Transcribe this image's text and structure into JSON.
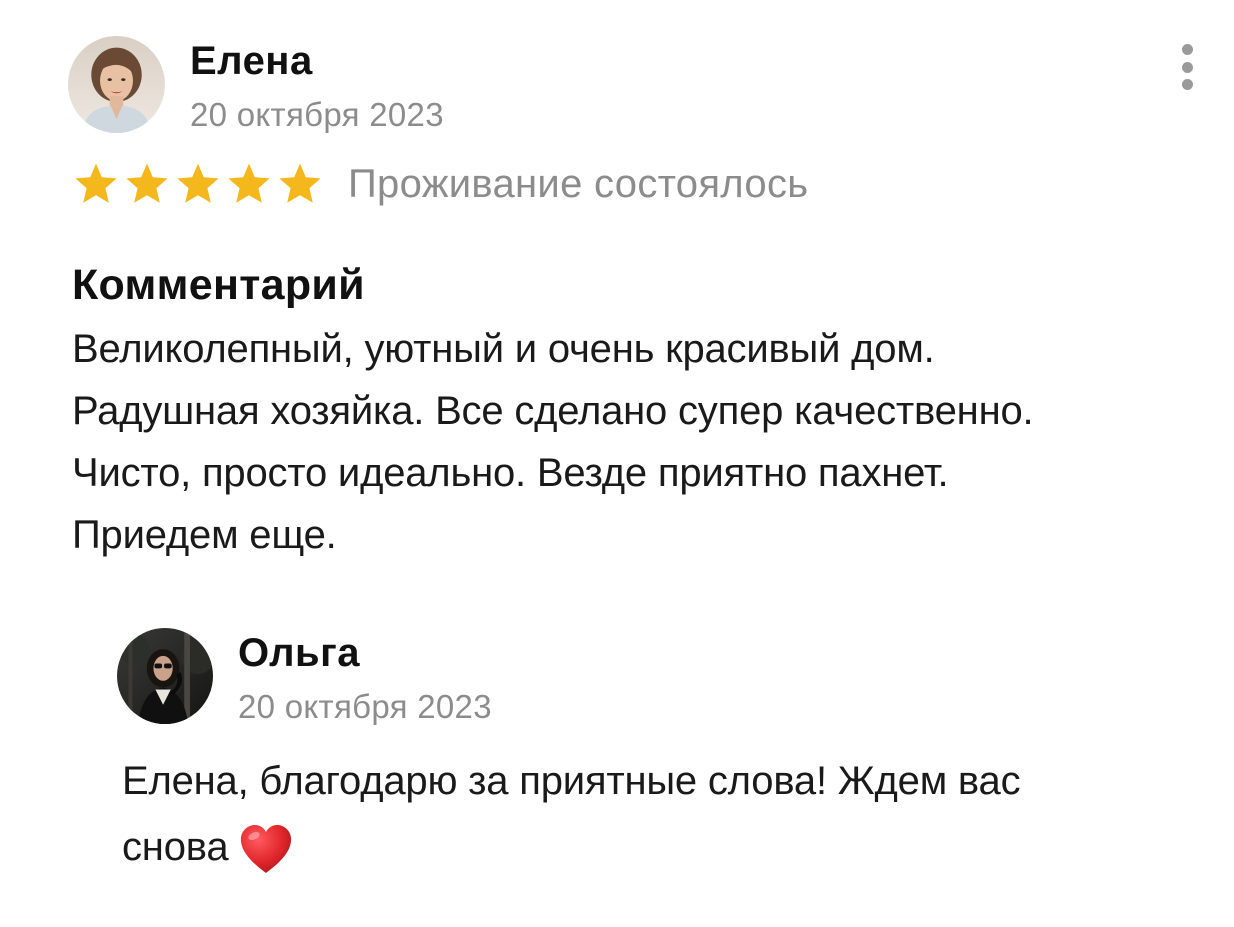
{
  "review": {
    "author": "Елена",
    "date": "20 октября 2023",
    "rating": 5,
    "rating_max": 5,
    "star_color": "#f5b81c",
    "stay_status": "Проживание состоялось",
    "menu_icon": "more-vertical-icon",
    "comment_heading": "Комментарий",
    "comment_lines": [
      "Великолепный, уютный и очень красивый дом.",
      "Радушная хозяйка. Все сделано супер качественно.",
      "Чисто, просто идеально. Везде приятно пахнет.",
      "Приедем еще."
    ]
  },
  "reply": {
    "author": "Ольга",
    "date": "20 октября 2023",
    "text_lines": [
      "Елена, благодарю за приятные слова! Ждем вас",
      "снова"
    ],
    "emoji": "heart-icon",
    "emoji_color": "#e0262b"
  }
}
